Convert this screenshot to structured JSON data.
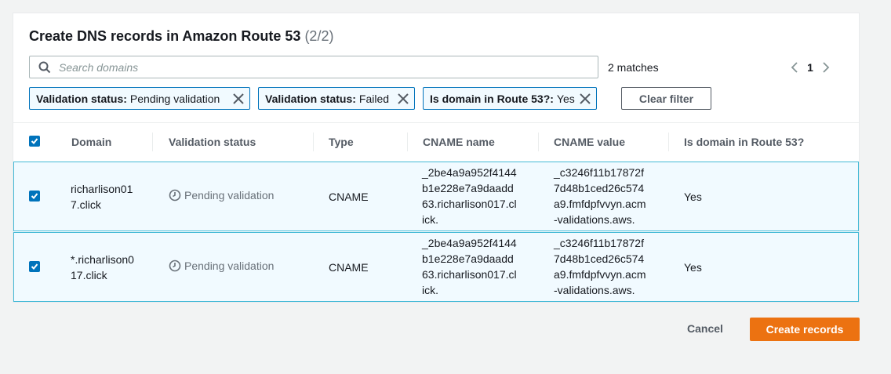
{
  "header": {
    "title": "Create DNS records in Amazon Route 53",
    "count": "(2/2)"
  },
  "search": {
    "placeholder": "Search domains",
    "value": ""
  },
  "matches": "2 matches",
  "pagination": {
    "current": "1"
  },
  "filters": [
    {
      "key": "Validation status:",
      "value": "Pending validation"
    },
    {
      "key": "Validation status:",
      "value": "Failed"
    },
    {
      "key": "Is domain in Route 53?:",
      "value": "Yes"
    }
  ],
  "clear_filter_label": "Clear filter",
  "table": {
    "columns": [
      "Domain",
      "Validation status",
      "Type",
      "CNAME name",
      "CNAME value",
      "Is domain in Route 53?"
    ],
    "rows": [
      {
        "selected": true,
        "domain": [
          "richarlison01",
          "7.click"
        ],
        "status": "Pending validation",
        "type": "CNAME",
        "cname_name": [
          "_2be4a9a952f4144",
          "b1e228e7a9daadd",
          "63.richarlison017.cl",
          "ick."
        ],
        "cname_value": [
          "_c3246f11b17872f",
          "7d48b1ced26c574",
          "a9.fmfdpfvvyn.acm",
          "-validations.aws."
        ],
        "in_route53": "Yes"
      },
      {
        "selected": true,
        "domain": [
          "*.richarlison0",
          "17.click"
        ],
        "status": "Pending validation",
        "type": "CNAME",
        "cname_name": [
          "_2be4a9a952f4144",
          "b1e228e7a9daadd",
          "63.richarlison017.cl",
          "ick."
        ],
        "cname_value": [
          "_c3246f11b17872f",
          "7d48b1ced26c574",
          "a9.fmfdpfvvyn.acm",
          "-validations.aws."
        ],
        "in_route53": "Yes"
      }
    ]
  },
  "footer": {
    "cancel_label": "Cancel",
    "create_label": "Create records"
  },
  "colors": {
    "primary": "#ec7211",
    "selected_row_bg": "#f1faff",
    "selected_row_border": "#44b9d6",
    "checkbox": "#0073bb"
  },
  "icons": [
    "search-icon",
    "chevron-left-icon",
    "chevron-right-icon",
    "close-icon",
    "clock-icon",
    "check-icon"
  ]
}
